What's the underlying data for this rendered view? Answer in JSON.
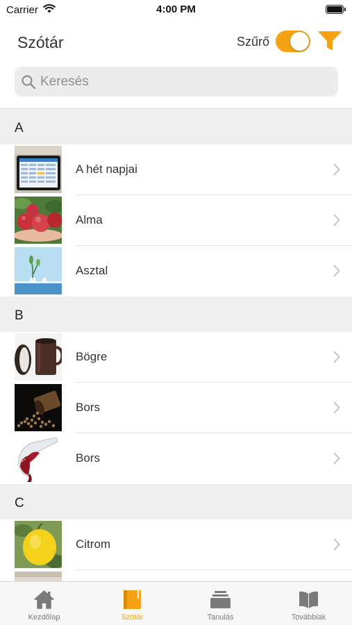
{
  "status_bar": {
    "carrier": "Carrier",
    "time": "4:00 PM"
  },
  "nav": {
    "title": "Szótár",
    "filter_label": "Szűrő",
    "filter_toggle_on": true
  },
  "search": {
    "placeholder": "Keresés"
  },
  "colors": {
    "accent": "#f5a314",
    "section_bg": "#efefef",
    "tab_inactive": "#7a7a7a"
  },
  "sections": [
    {
      "letter": "A",
      "items": [
        {
          "label": "A hét napjai",
          "image": "tablet-calendar"
        },
        {
          "label": "Alma",
          "image": "apples"
        },
        {
          "label": "Asztal",
          "image": "table"
        }
      ]
    },
    {
      "letter": "B",
      "items": [
        {
          "label": "Bögre",
          "image": "mug"
        },
        {
          "label": "Bors",
          "image": "peppercorns"
        },
        {
          "label": "Bors",
          "image": "wine-glass"
        }
      ]
    },
    {
      "letter": "C",
      "items": [
        {
          "label": "Citrom",
          "image": "lemon"
        }
      ]
    }
  ],
  "tabs": [
    {
      "label": "Kezdőlap",
      "icon": "home-icon",
      "active": false
    },
    {
      "label": "Szótár",
      "icon": "book-icon",
      "active": true
    },
    {
      "label": "Tanulás",
      "icon": "stack-icon",
      "active": false
    },
    {
      "label": "Továbbiak",
      "icon": "open-book-icon",
      "active": false
    }
  ]
}
